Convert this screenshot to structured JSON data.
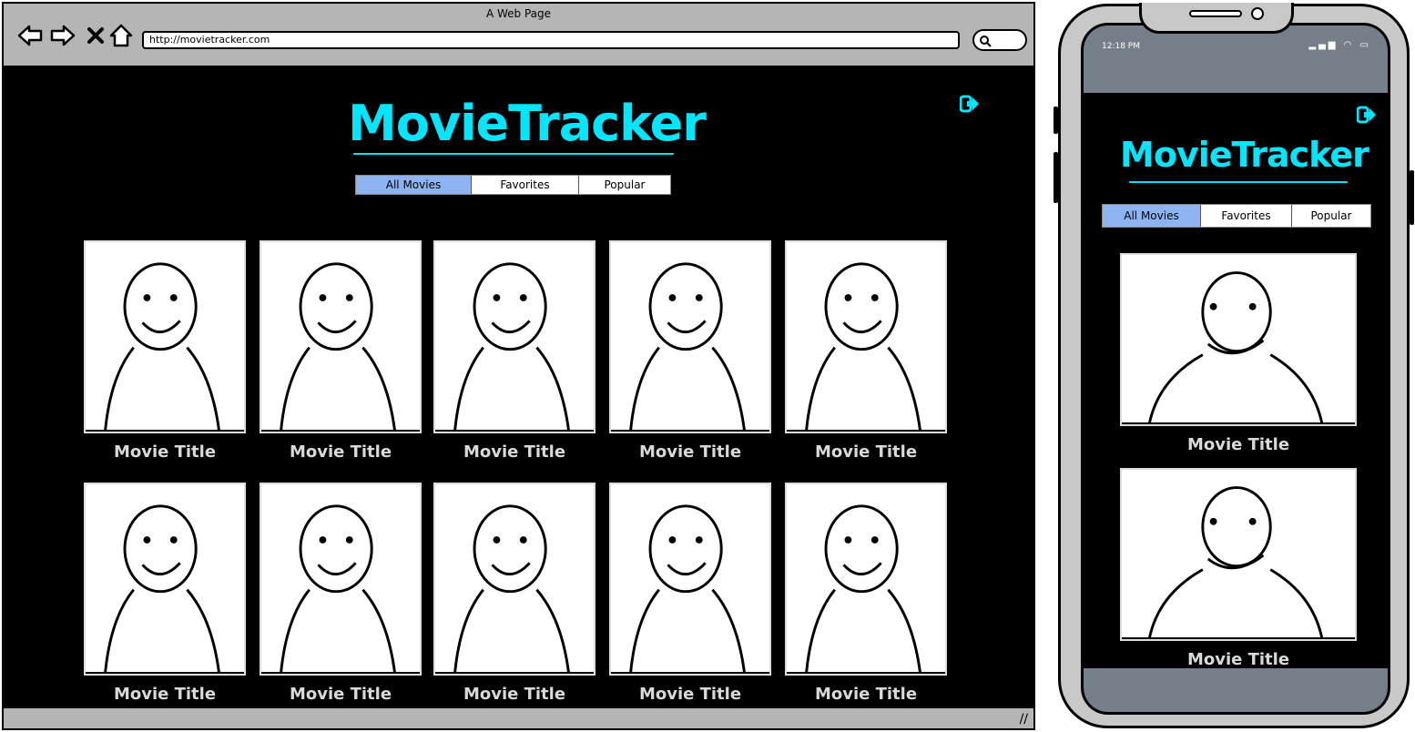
{
  "browser": {
    "window_title": "A Web Page",
    "url": "http://movietracker.com",
    "nav": {
      "back_icon": "back-arrow-icon",
      "forward_icon": "forward-arrow-icon",
      "close_icon": "close-x-icon",
      "home_icon": "home-icon",
      "search_icon": "search-icon"
    }
  },
  "app": {
    "logo": "MovieTracker",
    "logout_icon": "logout-icon",
    "accent_color": "#00e6ff",
    "active_tab_color": "#8db3f0",
    "tabs": [
      {
        "label": "All Movies",
        "active": true
      },
      {
        "label": "Favorites",
        "active": false
      },
      {
        "label": "Popular",
        "active": false
      }
    ]
  },
  "desktop": {
    "movies": [
      {
        "title": "Movie Title"
      },
      {
        "title": "Movie Title"
      },
      {
        "title": "Movie Title"
      },
      {
        "title": "Movie Title"
      },
      {
        "title": "Movie Title"
      },
      {
        "title": "Movie Title"
      },
      {
        "title": "Movie Title"
      },
      {
        "title": "Movie Title"
      },
      {
        "title": "Movie Title"
      },
      {
        "title": "Movie Title"
      }
    ]
  },
  "phone": {
    "time": "12:18 PM",
    "status_icons": [
      "signal-icon",
      "wifi-icon",
      "battery-icon"
    ],
    "movies": [
      {
        "title": "Movie Title"
      },
      {
        "title": "Movie Title"
      }
    ]
  }
}
